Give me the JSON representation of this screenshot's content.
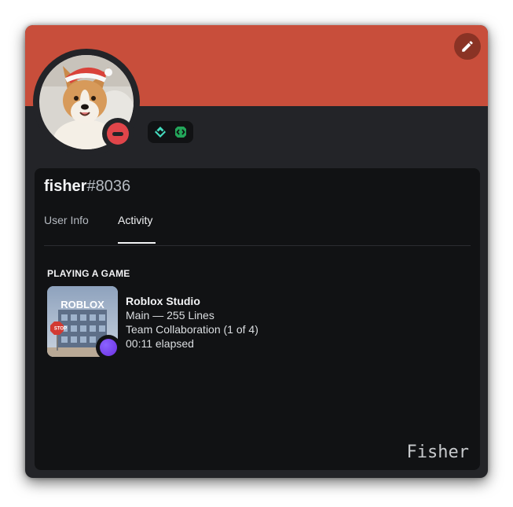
{
  "profile": {
    "username": "fisher",
    "discriminator": "#8036",
    "banner_color": "#c84e3b",
    "status": "do-not-disturb",
    "badges": [
      "hypesquad-icon",
      "active-developer-icon"
    ]
  },
  "tabs": [
    {
      "label": "User Info",
      "active": false
    },
    {
      "label": "Activity",
      "active": true
    }
  ],
  "activity": {
    "section_title": "PLAYING A GAME",
    "game_art_text": "ROBLOX",
    "game_art_sign": "STOP",
    "name": "Roblox Studio",
    "details": "Main — 255 Lines",
    "state": "Team Collaboration (1 of 4)",
    "elapsed": "00:11 elapsed"
  },
  "watermark": "Fisher",
  "icons": {
    "edit": "pencil-icon",
    "status": "dnd-icon"
  }
}
